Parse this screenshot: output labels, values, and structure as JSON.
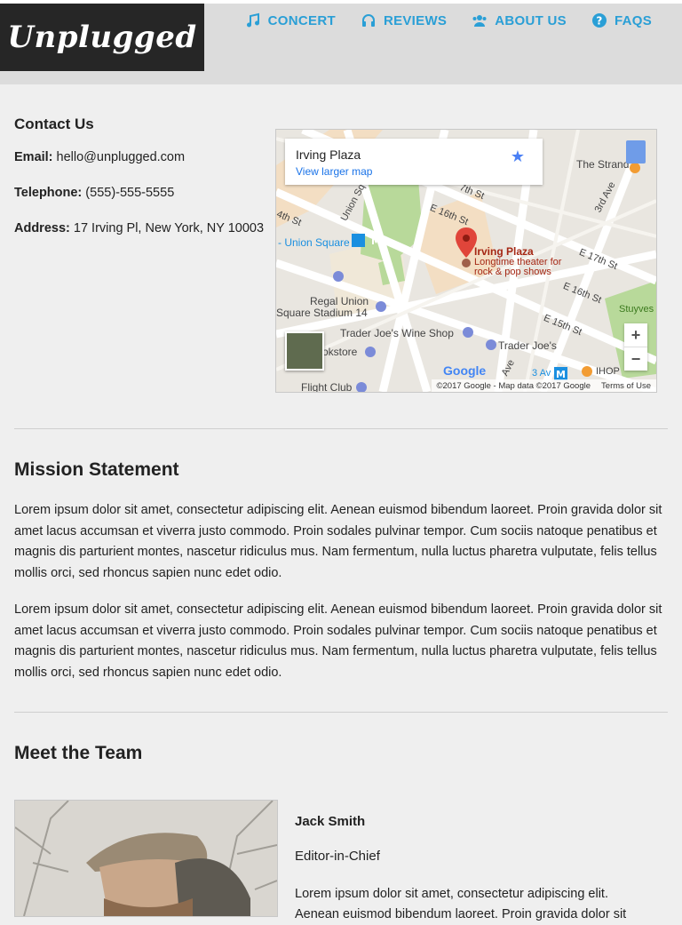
{
  "brand": {
    "logo_text": "Unplugged"
  },
  "nav": {
    "items": [
      {
        "label": "CONCERT",
        "icon": "music-note-icon"
      },
      {
        "label": "REVIEWS",
        "icon": "headphones-icon"
      },
      {
        "label": "ABOUT US",
        "icon": "users-icon"
      },
      {
        "label": "FAQS",
        "icon": "question-circle-icon"
      }
    ]
  },
  "contact": {
    "heading": "Contact Us",
    "email_label": "Email:",
    "email_value": "hello@unplugged.com",
    "phone_label": "Telephone:",
    "phone_value": "(555)-555-5555",
    "address_label": "Address:",
    "address_value": "17 Irving Pl, New York, NY 10003"
  },
  "map": {
    "place_title": "Irving Plaza",
    "view_larger": "View larger map",
    "pin_title": "Irving Plaza",
    "pin_desc_1": "Longtime theater for",
    "pin_desc_2": "rock & pop shows",
    "labels": {
      "union_square": "- Union Square",
      "regal_1": "Regal Union",
      "regal_2": "Square Stadium 14",
      "tj_wine": "Trader Joe's Wine Shop",
      "tj": "Trader Joe's",
      "bookstore": "okstore",
      "flight_club": "Flight Club",
      "the_strand": "The Strand",
      "stuyves": "Stuyves",
      "ihop": "IHOP",
      "av3": "3 Av",
      "e16": "E 16th St",
      "e17": "E 17th St",
      "e16b": "E 16th St",
      "e15": "E 15th St",
      "ave3": "3rd Ave",
      "union_sq_w": "Union Sq",
      "st17": "7th St",
      "st14": "4th St",
      "ave": "Ave"
    },
    "zoom_in": "+",
    "zoom_out": "−",
    "copyright": "©2017 Google - Map data ©2017 Google",
    "terms": "Terms of Use",
    "google": "Google"
  },
  "mission": {
    "heading": "Mission Statement",
    "p1": "Lorem ipsum dolor sit amet, consectetur adipiscing elit. Aenean euismod bibendum laoreet. Proin gravida dolor sit amet lacus accumsan et viverra justo commodo. Proin sodales pulvinar tempor. Cum sociis natoque penatibus et magnis dis parturient montes, nascetur ridiculus mus. Nam fermentum, nulla luctus pharetra vulputate, felis tellus mollis orci, sed rhoncus sapien nunc edet odio.",
    "p2": "Lorem ipsum dolor sit amet, consectetur adipiscing elit. Aenean euismod bibendum laoreet. Proin gravida dolor sit amet lacus accumsan et viverra justo commodo. Proin sodales pulvinar tempor. Cum sociis natoque penatibus et magnis dis parturient montes, nascetur ridiculus mus. Nam fermentum, nulla luctus pharetra vulputate, felis tellus mollis orci, sed rhoncus sapien nunc edet odio."
  },
  "team": {
    "heading": "Meet the Team",
    "members": [
      {
        "name": "Jack Smith",
        "role": "Editor-in-Chief",
        "bio": "Lorem ipsum dolor sit amet, consectetur adipiscing elit. Aenean euismod bibendum laoreet. Proin gravida dolor sit"
      }
    ]
  },
  "colors": {
    "accent": "#2a9fd6",
    "logo_bg": "#262626",
    "page_bg": "#efefef"
  }
}
